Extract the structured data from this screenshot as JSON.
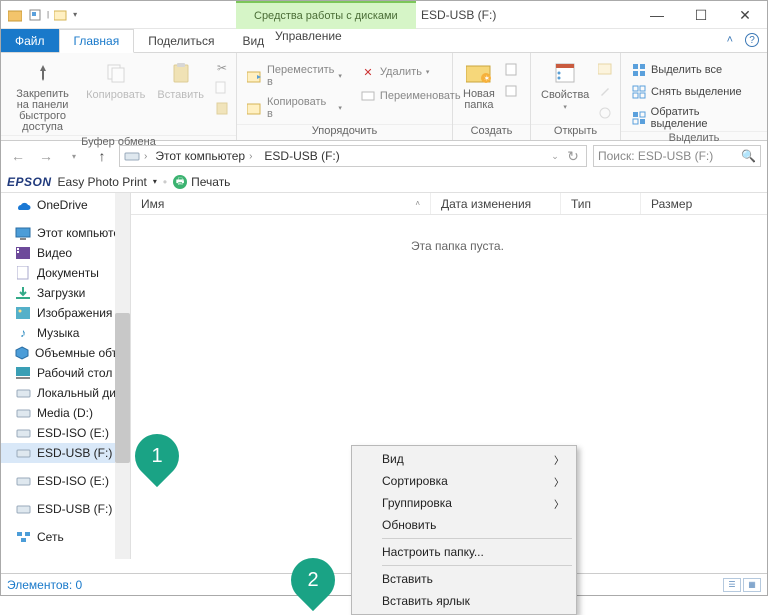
{
  "title": "ESD-USB (F:)",
  "context_tab_group": "Средства работы с дисками",
  "tabs": {
    "file": "Файл",
    "home": "Главная",
    "share": "Поделиться",
    "view": "Вид",
    "manage": "Управление"
  },
  "ribbon": {
    "clipboard": {
      "label": "Буфер обмена",
      "pin": "Закрепить на панели\nбыстрого доступа",
      "copy": "Копировать",
      "paste": "Вставить"
    },
    "organize": {
      "label": "Упорядочить",
      "move": "Переместить в",
      "copyto": "Копировать в",
      "delete": "Удалить",
      "rename": "Переименовать"
    },
    "new": {
      "label": "Создать",
      "newfolder": "Новая\nпапка"
    },
    "open": {
      "label": "Открыть",
      "properties": "Свойства"
    },
    "select": {
      "label": "Выделить",
      "all": "Выделить все",
      "none": "Снять выделение",
      "invert": "Обратить выделение"
    }
  },
  "breadcrumb": {
    "root": "Этот компьютер",
    "current": "ESD-USB (F:)"
  },
  "search_placeholder": "Поиск: ESD-USB (F:)",
  "epson": {
    "brand": "EPSON",
    "epp": "Easy Photo Print",
    "print": "Печать"
  },
  "columns": {
    "name": "Имя",
    "date": "Дата изменения",
    "type": "Тип",
    "size": "Размер"
  },
  "empty_text": "Эта папка пуста.",
  "nav": {
    "onedrive": "OneDrive",
    "thispc": "Этот компьютер",
    "items": [
      "Видео",
      "Документы",
      "Загрузки",
      "Изображения",
      "Музыка",
      "Объемные объекты",
      "Рабочий стол",
      "Локальный диск",
      "Media (D:)",
      "ESD-ISO (E:)",
      "ESD-USB (F:)"
    ],
    "dup": [
      "ESD-ISO (E:)",
      "ESD-USB (F:)"
    ],
    "network": "Сеть"
  },
  "context_menu": {
    "view": "Вид",
    "sort": "Сортировка",
    "group": "Группировка",
    "refresh": "Обновить",
    "customize": "Настроить папку...",
    "paste": "Вставить",
    "paste_shortcut": "Вставить ярлык"
  },
  "status": "Элементов: 0",
  "callouts": {
    "one": "1",
    "two": "2"
  }
}
